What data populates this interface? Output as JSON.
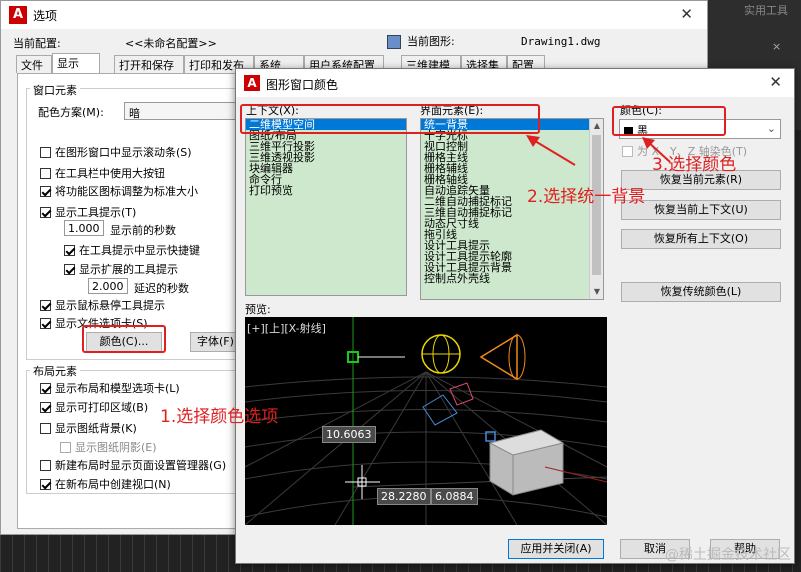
{
  "background": {
    "toolbar_label": "实用工具",
    "toolbar_close": "×"
  },
  "options_dialog": {
    "title": "选项",
    "close": "✕",
    "current_profile_label": "当前配置:",
    "current_profile_value": "<<未命名配置>>",
    "current_drawing_label": "当前图形:",
    "current_drawing_value": "Drawing1.dwg",
    "tabs": [
      "文件",
      "显示",
      "打开和保存",
      "打印和发布",
      "系统",
      "用户系统配置",
      "绘图",
      "三维建模",
      "选择集",
      "配置"
    ],
    "window_elements": {
      "title": "窗口元素",
      "color_scheme_label": "配色方案(M):",
      "color_scheme_value": "暗",
      "checks": [
        {
          "label": "在图形窗口中显示滚动条(S)",
          "checked": false
        },
        {
          "label": "在工具栏中使用大按钮",
          "checked": false
        },
        {
          "label": "将功能区图标调整为标准大小",
          "checked": true
        },
        {
          "label": "显示工具提示(T)",
          "checked": true
        }
      ],
      "delay_value": "1.000",
      "delay_label": "显示前的秒数",
      "shortcut_check": {
        "label": "在工具提示中显示快捷键",
        "checked": true
      },
      "extended_check": {
        "label": "显示扩展的工具提示",
        "checked": true
      },
      "ext_delay_value": "2.000",
      "ext_delay_label": "延迟的秒数",
      "hover_check": {
        "label": "显示鼠标悬停工具提示",
        "checked": true
      },
      "filetab_check": {
        "label": "显示文件选项卡(S)",
        "checked": true
      },
      "color_button": "颜色(C)...",
      "font_button": "字体(F)"
    },
    "layout_elements": {
      "title": "布局元素",
      "checks": [
        {
          "label": "显示布局和模型选项卡(L)",
          "checked": true
        },
        {
          "label": "显示可打印区域(B)",
          "checked": true
        },
        {
          "label": "显示图纸背景(K)",
          "checked": false
        },
        {
          "label": "显示图纸阴影(E)",
          "checked": false
        },
        {
          "label": "新建布局时显示页面设置管理器(G)",
          "checked": false
        },
        {
          "label": "在新布局中创建视口(N)",
          "checked": true
        }
      ]
    }
  },
  "color_dialog": {
    "title": "图形窗口颜色",
    "close": "✕",
    "context_label": "上下文(X):",
    "contexts": [
      "二维模型空间",
      "图纸/布局",
      "三维平行投影",
      "三维透视投影",
      "块编辑器",
      "命令行",
      "打印预览"
    ],
    "interface_label": "界面元素(E):",
    "interface_elements": [
      "统一背景",
      "十字光标",
      "视口控制",
      "栅格主线",
      "栅格辅线",
      "栅格轴线",
      "自动追踪矢量",
      "二维自动捕捉标记",
      "三维自动捕捉标记",
      "动态尺寸线",
      "拖引线",
      "设计工具提示",
      "设计工具提示轮廓",
      "设计工具提示背景",
      "控制点外壳线"
    ],
    "color_label": "颜色(C):",
    "color_value": "黑",
    "tint_label": "为 X、Y、Z 轴染色(T)",
    "buttons": {
      "restore_element": "恢复当前元素(R)",
      "restore_context": "恢复当前上下文(U)",
      "restore_all": "恢复所有上下文(O)",
      "restore_classic": "恢复传统颜色(L)",
      "apply_close": "应用并关闭(A)",
      "cancel": "取消",
      "help": "帮助"
    },
    "preview_label": "预览:",
    "viewport_label": "[+][上][X-射线]",
    "coord_1": "10.6063",
    "coord_2": "28.2280",
    "coord_3": "6.0884"
  },
  "annotations": {
    "step1": "1.选择颜色选项",
    "step2": "2.选择统一背景",
    "step3": "3.选择颜色",
    "color": "#e02020"
  },
  "watermark": "@稀土掘金技术社区"
}
